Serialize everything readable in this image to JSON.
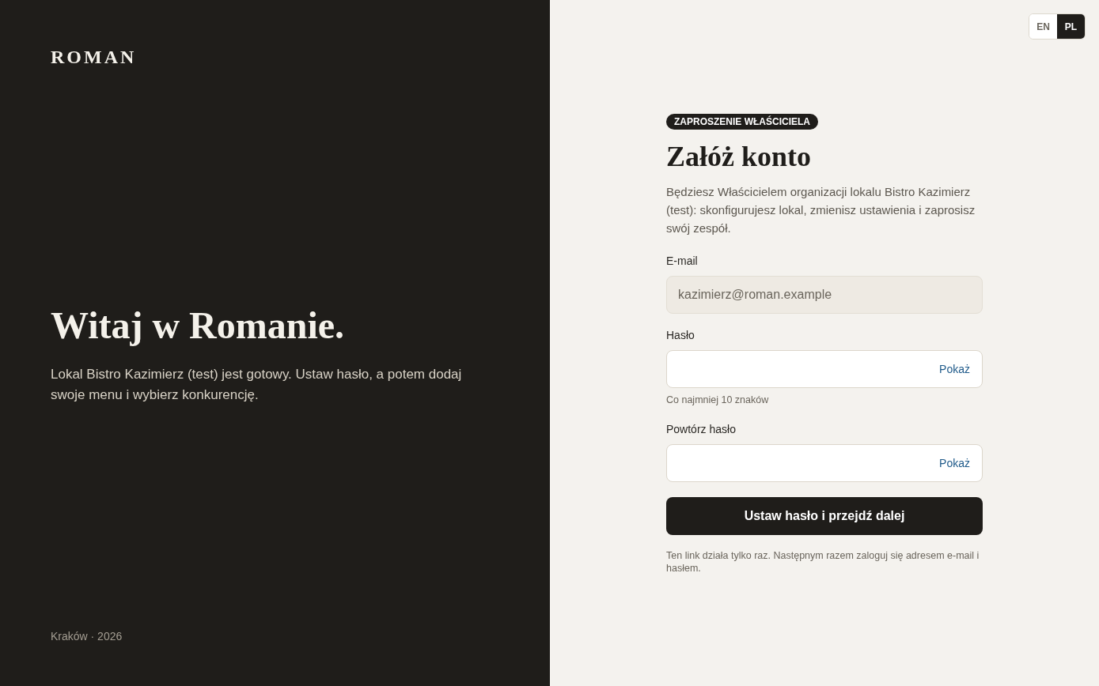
{
  "brand": {
    "logo": "ROMAN"
  },
  "hero": {
    "title": "Witaj w Romanie.",
    "text": "Lokal Bistro Kazimierz (test) jest gotowy. Ustaw hasło, a potem dodaj swoje menu i wybierz konkurencję."
  },
  "footer": {
    "text": "Kraków · 2026"
  },
  "language_switch": [
    {
      "label": "EN",
      "selected": false
    },
    {
      "label": "PL",
      "selected": true
    }
  ],
  "form": {
    "badge": "ZAPROSZENIE WŁAŚCICIELA",
    "title": "Załóż konto",
    "intro": "Będziesz Właścicielem organizacji lokalu Bistro Kazimierz (test): skonfigurujesz lokal, zmienisz ustawienia i zaprosisz swój zespół.",
    "fields": [
      {
        "kind": "email",
        "label": "E-mail",
        "value": "kazimierz@roman.example",
        "disabled": true
      },
      {
        "kind": "password",
        "label": "Hasło",
        "toggle": "Pokaż",
        "hint": "Co najmniej 10 znaków",
        "disabled": false
      },
      {
        "kind": "password",
        "label": "Powtórz hasło",
        "toggle": "Pokaż",
        "disabled": false
      }
    ],
    "submit": "Ustaw hasło i przejdź dalej",
    "note": "Ten link działa tylko raz. Następnym razem zaloguj się adresem e-mail i hasłem."
  }
}
